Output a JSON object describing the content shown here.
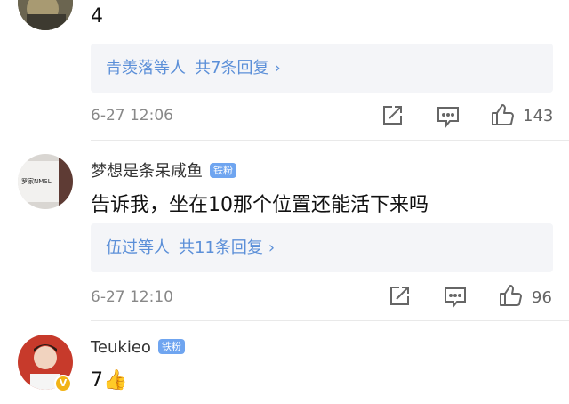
{
  "comments": [
    {
      "text": "4",
      "reply": {
        "users": "青羡落等人",
        "count": "共7条回复",
        "chevron": "›"
      },
      "time": "6-27 12:06",
      "likes": "143"
    },
    {
      "username": "梦想是条呆咸鱼",
      "badge": "铁粉",
      "avatar_text": "罗家NMSL",
      "text": "告诉我，坐在10那个位置还能活下来吗",
      "reply": {
        "users": "伍过等人",
        "count": "共11条回复",
        "chevron": "›"
      },
      "time": "6-27 12:10",
      "likes": "96"
    },
    {
      "username": "Teukieo",
      "badge": "铁粉",
      "text": "7👍",
      "avatar_badge": "V"
    }
  ],
  "colors": {
    "link": "#5b8fd8",
    "badge": "#6fa5f0",
    "reply_bg": "#f4f5f8",
    "meta": "#888888"
  }
}
